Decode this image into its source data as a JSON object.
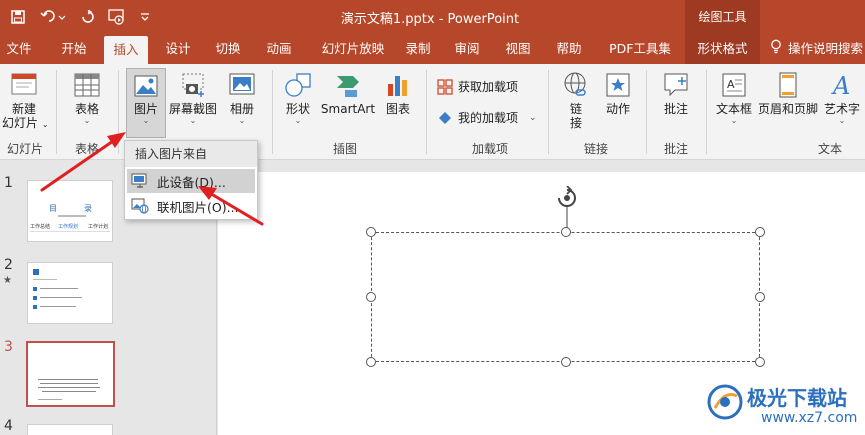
{
  "window": {
    "title": "演示文稿1.pptx  -  PowerPoint",
    "context_tab_group": "绘图工具"
  },
  "quick_access": {
    "icons": [
      "save-icon",
      "undo-icon",
      "redo-icon",
      "present-from-start-icon",
      "customize-icon"
    ]
  },
  "tabs": [
    {
      "label": "文件"
    },
    {
      "label": "开始"
    },
    {
      "label": "插入",
      "active": true
    },
    {
      "label": "设计"
    },
    {
      "label": "切换"
    },
    {
      "label": "动画"
    },
    {
      "label": "幻灯片放映"
    },
    {
      "label": "录制"
    },
    {
      "label": "审阅"
    },
    {
      "label": "视图"
    },
    {
      "label": "帮助"
    },
    {
      "label": "PDF工具集"
    },
    {
      "label": "形状格式"
    },
    {
      "label": "操作说明搜索"
    }
  ],
  "ribbon": {
    "new_slide": {
      "label_line1": "新建",
      "label_line2": "幻灯片"
    },
    "table": {
      "label": "表格"
    },
    "picture": {
      "label": "图片"
    },
    "screenshot": {
      "label": "屏幕截图"
    },
    "album": {
      "label": "相册"
    },
    "shapes": {
      "label": "形状"
    },
    "smartart": {
      "label": "SmartArt"
    },
    "chart": {
      "label": "图表"
    },
    "get_addins": {
      "label": "获取加载项"
    },
    "my_addins": {
      "label": "我的加载项"
    },
    "link": {
      "label_line1": "链",
      "label_line2": "接"
    },
    "action": {
      "label": "动作"
    },
    "comment": {
      "label": "批注"
    },
    "textbox": {
      "label": "文本框"
    },
    "header_footer": {
      "label": "页眉和页脚"
    },
    "wordart": {
      "label": "艺术字"
    },
    "groups": {
      "slides": "幻灯片",
      "tables": "表格",
      "illustrations": "插图",
      "addins": "加载项",
      "links": "链接",
      "comments": "批注",
      "text": "文本"
    }
  },
  "picture_dropdown": {
    "header": "插入图片来自",
    "items": [
      {
        "label": "此设备(D)...",
        "highlighted": true
      },
      {
        "label": "联机图片(O)..."
      }
    ]
  },
  "slides_pane": {
    "numbers": [
      "1",
      "2",
      "3",
      "4"
    ],
    "slide1": {
      "heading_left": "目",
      "heading_right": "录",
      "col1": "工作总结",
      "col2": "工作规划",
      "col3": "工作计划"
    },
    "selected": "3"
  },
  "watermark": {
    "text": "极光下载站",
    "url": "www.xz7.com"
  },
  "colors": {
    "brand": "#b7472a",
    "selected_thumb_border": "#c0504d",
    "annotation_arrow": "#e02020"
  }
}
